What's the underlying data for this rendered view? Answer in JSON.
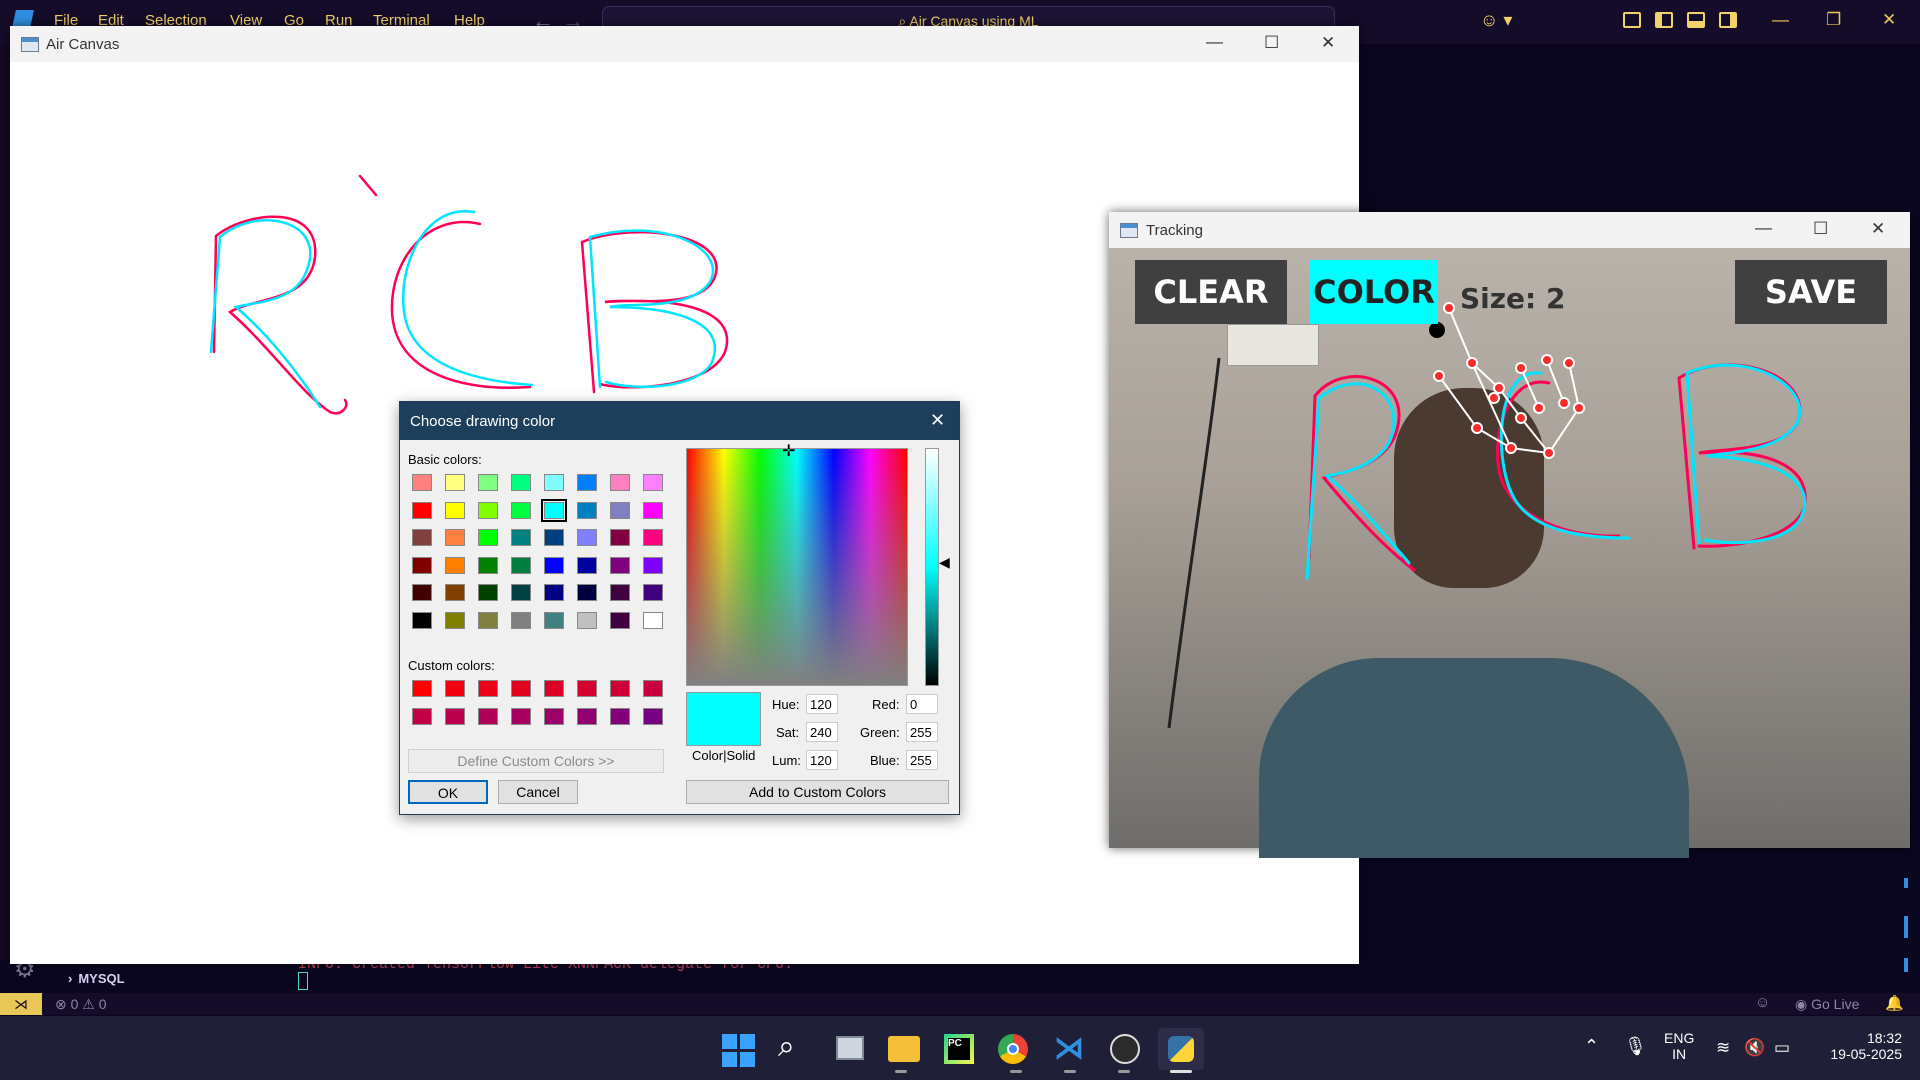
{
  "vscode": {
    "menu": [
      "File",
      "Edit",
      "Selection",
      "View",
      "Go",
      "Run",
      "Terminal",
      "Help"
    ],
    "search_text": "Air Canvas using ML",
    "sidebar_item": "MYSQL",
    "terminal_line": "INFO: Created TensorFlow Lite XNNPACK delegate for CPU.",
    "problems_errors": "0",
    "problems_warnings": "0",
    "go_live": "Go Live",
    "colors": {
      "accent": "#f2d36a",
      "background": "#140a26"
    }
  },
  "air_canvas": {
    "title": "Air Canvas",
    "drawing_letters": [
      "R",
      "C",
      "B"
    ],
    "stroke_colors": [
      "#ff0055",
      "#00e5ff"
    ]
  },
  "dialog": {
    "title": "Choose drawing color",
    "basic_colors_label": "Basic colors:",
    "custom_colors_label": "Custom colors:",
    "define_custom": "Define Custom Colors >>",
    "ok": "OK",
    "cancel": "Cancel",
    "color_solid": "Color|Solid",
    "add_custom": "Add to Custom Colors",
    "hue_label": "Hue:",
    "hue": "120",
    "sat_label": "Sat:",
    "sat": "240",
    "lum_label": "Lum:",
    "lum": "120",
    "red_label": "Red:",
    "red": "0",
    "green_label": "Green:",
    "green": "255",
    "blue_label": "Blue:",
    "blue": "255",
    "selected_color": "#00ffff",
    "basic_colors": [
      [
        "#ff8080",
        "#ffff80",
        "#80ff80",
        "#00ff80",
        "#80ffff",
        "#0080ff",
        "#ff80c0",
        "#ff80ff"
      ],
      [
        "#ff0000",
        "#ffff00",
        "#80ff00",
        "#00ff40",
        "#00ffff",
        "#0080c0",
        "#8080c0",
        "#ff00ff"
      ],
      [
        "#804040",
        "#ff8040",
        "#00ff00",
        "#008080",
        "#004080",
        "#8080ff",
        "#800040",
        "#ff0080"
      ],
      [
        "#800000",
        "#ff8000",
        "#008000",
        "#008040",
        "#0000ff",
        "#0000a0",
        "#800080",
        "#8000ff"
      ],
      [
        "#400000",
        "#804000",
        "#004000",
        "#004040",
        "#000080",
        "#000040",
        "#400040",
        "#400080"
      ],
      [
        "#000000",
        "#808000",
        "#808040",
        "#808080",
        "#408080",
        "#c0c0c0",
        "#400040",
        "#ffffff"
      ]
    ],
    "custom_colors": [
      [
        "#ff0000",
        "#f20010",
        "#ea0018",
        "#e2001f",
        "#dd0026",
        "#d6002e",
        "#cf0036",
        "#c8003e"
      ],
      [
        "#c10046",
        "#ba004e",
        "#b30057",
        "#a8005f",
        "#9c0068",
        "#900070",
        "#84007a",
        "#780082"
      ]
    ]
  },
  "tracking": {
    "title": "Tracking",
    "clear": "CLEAR",
    "color": "COLOR",
    "size_label": "Size: 2",
    "save": "SAVE"
  },
  "taskbar": {
    "language": "ENG",
    "region": "IN",
    "time": "18:32",
    "date": "19-05-2025"
  }
}
